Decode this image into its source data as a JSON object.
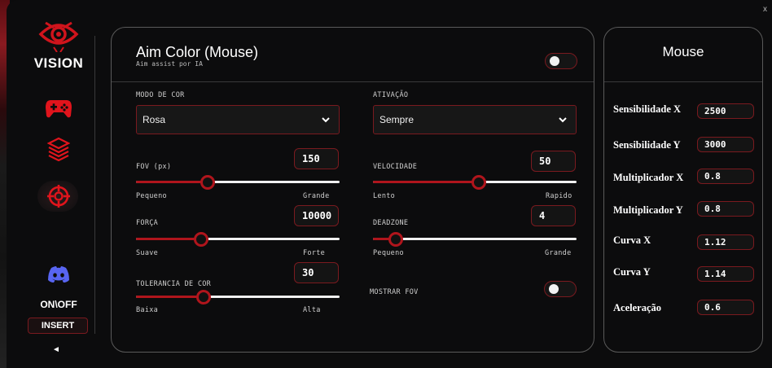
{
  "window": {
    "close_label": "x"
  },
  "sidebar": {
    "brand": "VISION",
    "icons": [
      "eye-logo-icon",
      "gamepad-icon",
      "layers-icon",
      "crosshair-icon",
      "discord-icon"
    ],
    "onoff_label": "ON\\OFF",
    "insert_label": "INSERT",
    "collapse_label": "◄"
  },
  "main": {
    "title": "Aim Color (Mouse)",
    "subtitle": "Aim assist por IA",
    "enabled": false,
    "color_mode": {
      "label": "MODO DE COR",
      "value": "Rosa"
    },
    "activation": {
      "label": "ATIVAÇÃO",
      "value": "Sempre"
    },
    "fov": {
      "label": "FOV (px)",
      "value": "150",
      "min_label": "Pequeno",
      "max_label": "Grande",
      "level": 0.35
    },
    "speed": {
      "label": "VELOCIDADE",
      "value": "50",
      "min_label": "Lento",
      "max_label": "Rapido",
      "level": 0.52
    },
    "strength": {
      "label": "FORÇA",
      "value": "10000",
      "min_label": "Suave",
      "max_label": "Forte",
      "level": 0.32
    },
    "deadzone": {
      "label": "DEADZONE",
      "value": "4",
      "min_label": "Pequeno",
      "max_label": "Grande",
      "level": 0.11
    },
    "color_tolerance": {
      "label": "TOLERANCIA DE COR",
      "value": "30",
      "min_label": "Baixa",
      "max_label": "Alta",
      "level": 0.33
    },
    "show_fov": {
      "label": "MOSTRAR FOV",
      "enabled": false
    }
  },
  "mouse": {
    "title": "Mouse",
    "settings": [
      {
        "label": "Sensibilidade X",
        "value": "2500"
      },
      {
        "label": "Sensibilidade Y",
        "value": "3000"
      },
      {
        "label": "Multiplicador X",
        "value": "0.8"
      },
      {
        "label": "Multiplicador Y",
        "value": "0.8"
      },
      {
        "label": "Curva X",
        "value": "1.12"
      },
      {
        "label": "Curva Y",
        "value": "1.14"
      },
      {
        "label": "Aceleração",
        "value": "0.6"
      }
    ]
  },
  "colors": {
    "accent": "#b0151c",
    "border": "#7a1a1f",
    "background": "#0c0c0d",
    "discord": "#5865f2"
  }
}
